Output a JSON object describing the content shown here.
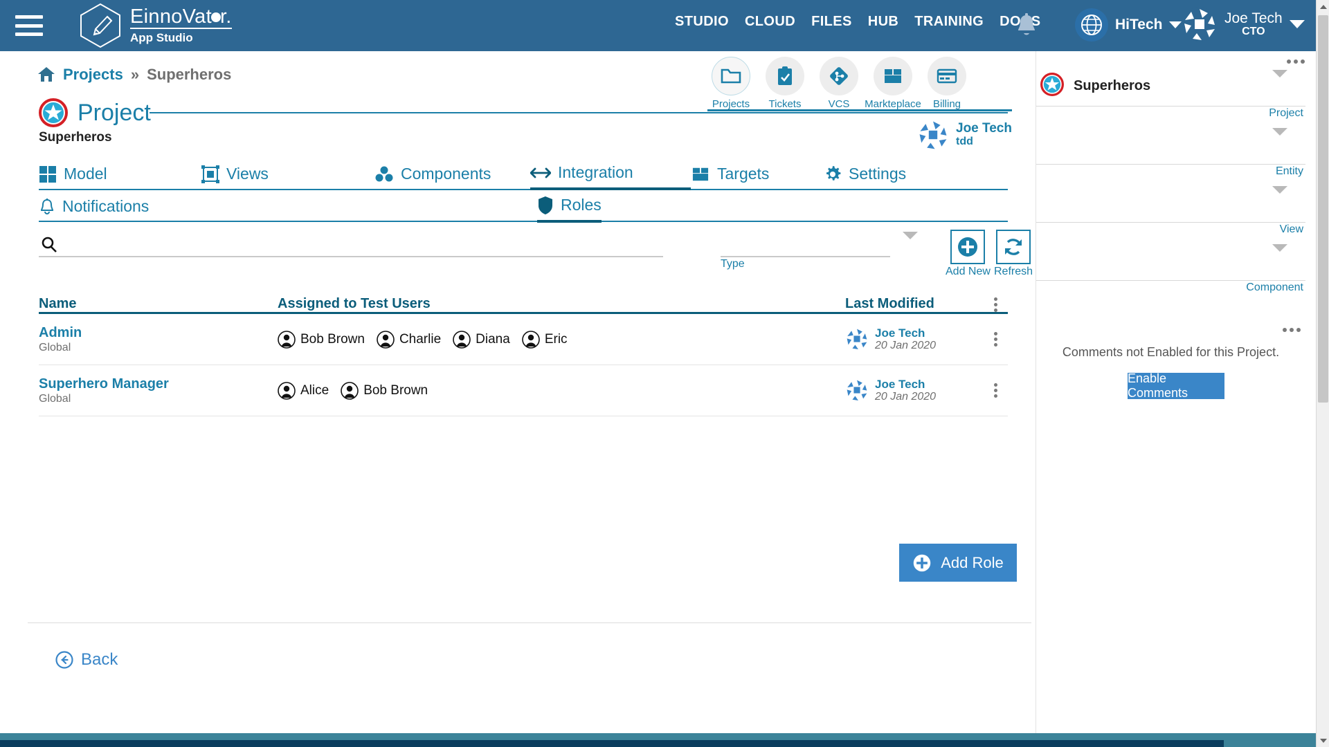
{
  "header": {
    "menu_icon": "hamburger-icon",
    "brand": {
      "name_part1": "Einno",
      "name_part2": "Vat",
      "name_part3": "r.",
      "subtitle": "App Studio"
    },
    "nav": [
      {
        "label": "STUDIO"
      },
      {
        "label": "CLOUD"
      },
      {
        "label": "FILES"
      },
      {
        "label": "HUB"
      },
      {
        "label": "TRAINING"
      },
      {
        "label": "DOCS"
      }
    ],
    "notifications_icon": "bell-icon",
    "org": {
      "name": "HiTech",
      "icon": "globe-icon"
    },
    "user": {
      "name": "Joe Tech",
      "role": "CTO"
    }
  },
  "breadcrumb": {
    "home_icon": "home-icon",
    "root": "Projects",
    "separator": "»",
    "current": "Superheros"
  },
  "page": {
    "kind_label": "Project",
    "project_name": "Superheros",
    "owner": {
      "name": "Joe Tech",
      "sub": "tdd"
    }
  },
  "quicknav": [
    {
      "label": "Projects",
      "icon": "folder-icon",
      "active": true
    },
    {
      "label": "Tickets",
      "icon": "clipboard-check-icon",
      "active": false
    },
    {
      "label": "VCS",
      "icon": "git-branch-icon",
      "active": false
    },
    {
      "label": "Markteplace",
      "icon": "box-icon",
      "active": false
    },
    {
      "label": "Billing",
      "icon": "credit-card-icon",
      "active": false
    }
  ],
  "tabs_row1": [
    {
      "label": "Model",
      "icon": "grid-icon",
      "active": false
    },
    {
      "label": "Views",
      "icon": "frame-icon",
      "active": false
    },
    {
      "label": "Components",
      "icon": "components-icon",
      "active": false
    },
    {
      "label": "Integration",
      "icon": "arrows-horizontal-icon",
      "active": true
    },
    {
      "label": "Targets",
      "icon": "box-icon",
      "active": false
    },
    {
      "label": "Settings",
      "icon": "gear-icon",
      "active": false
    }
  ],
  "tabs_row2": [
    {
      "label": "Notifications",
      "icon": "bell-icon",
      "active": false
    },
    {
      "label": "Roles",
      "icon": "shield-icon",
      "active": true
    }
  ],
  "filterbar": {
    "search": {
      "value": "",
      "placeholder": "",
      "icon": "search-icon"
    },
    "type": {
      "label": "Type",
      "value": "",
      "chevron": "chevron-down-icon"
    },
    "add_new": {
      "label": "Add New",
      "icon": "plus-circle-icon"
    },
    "refresh": {
      "label": "Refresh",
      "icon": "refresh-icon"
    }
  },
  "table": {
    "columns": [
      "Name",
      "Assigned to Test Users",
      "Last Modified"
    ],
    "rows": [
      {
        "name": "Admin",
        "scope": "Global",
        "users": [
          "Bob Brown",
          "Charlie",
          "Diana",
          "Eric"
        ],
        "modified_by": "Joe Tech",
        "modified_date": "20 Jan 2020"
      },
      {
        "name": "Superhero Manager",
        "scope": "Global",
        "users": [
          "Alice",
          "Bob Brown"
        ],
        "modified_by": "Joe Tech",
        "modified_date": "20 Jan 2020"
      }
    ]
  },
  "actions": {
    "add_role": {
      "label": "Add Role",
      "icon": "plus-circle-icon"
    },
    "back": {
      "label": "Back",
      "icon": "arrow-left-circle-icon"
    }
  },
  "right_panel": {
    "selectors": [
      {
        "caption": "Project",
        "value": "Superheros",
        "has_icon": true
      },
      {
        "caption": "Entity",
        "value": "",
        "has_icon": false
      },
      {
        "caption": "View",
        "value": "",
        "has_icon": false
      },
      {
        "caption": "Component",
        "value": "",
        "has_icon": false
      }
    ],
    "comments_note": "Comments not Enabled for this Project.",
    "enable_comments_label": "Enable Comments"
  },
  "colors": {
    "header_blue": "#2e6793",
    "accent_teal": "#1b7fa8",
    "dark_teal": "#0b5d7a",
    "button_blue": "#3a86c8",
    "footer_teal": "#3c8399",
    "footer_navy": "#0b3d5e"
  }
}
